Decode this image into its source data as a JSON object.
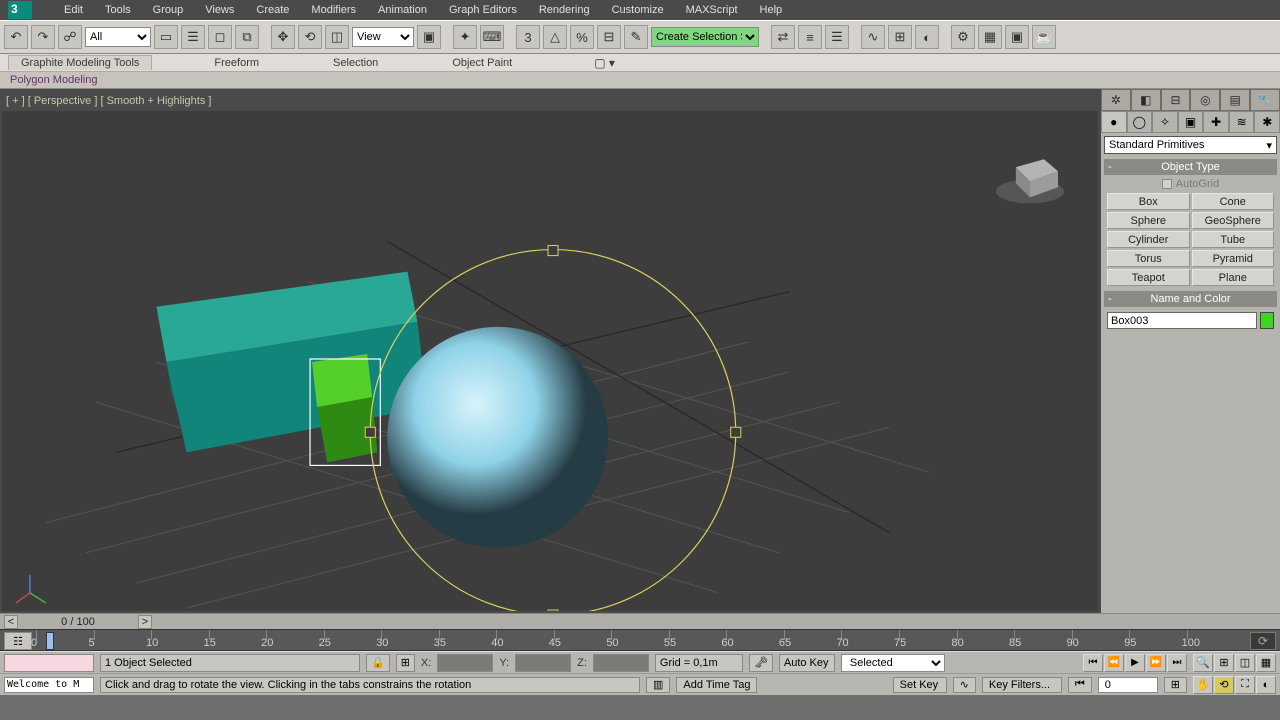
{
  "menu": {
    "items": [
      "Edit",
      "Tools",
      "Group",
      "Views",
      "Create",
      "Modifiers",
      "Animation",
      "Graph Editors",
      "Rendering",
      "Customize",
      "MAXScript",
      "Help"
    ]
  },
  "toolbar": {
    "filter_value": "All",
    "refsys_value": "View",
    "selset_value": "Create Selection Se"
  },
  "ribbon": {
    "tabs": [
      "Graphite Modeling Tools",
      "Freeform",
      "Selection",
      "Object Paint"
    ],
    "sub": "Polygon Modeling"
  },
  "viewport": {
    "label": "[ + ] [ Perspective ] [ Smooth + Highlights ]"
  },
  "panel": {
    "category": "Standard Primitives",
    "object_type_title": "Object Type",
    "autogrid": "AutoGrid",
    "primitives": [
      "Box",
      "Cone",
      "Sphere",
      "GeoSphere",
      "Cylinder",
      "Tube",
      "Torus",
      "Pyramid",
      "Teapot",
      "Plane"
    ],
    "name_color_title": "Name and Color",
    "object_name": "Box003"
  },
  "timeline": {
    "pos": "0 / 100",
    "ticks": [
      "0",
      "5",
      "10",
      "15",
      "20",
      "25",
      "30",
      "35",
      "40",
      "45",
      "50",
      "55",
      "60",
      "65",
      "70",
      "75",
      "80",
      "85",
      "90",
      "95",
      "100"
    ]
  },
  "status": {
    "selection": "1 Object Selected",
    "x": "X:",
    "y": "Y:",
    "z": "Z:",
    "grid": "Grid = 0,1m",
    "autokey": "Auto Key",
    "setkey": "Set Key",
    "selected_mode": "Selected",
    "key_filters": "Key Filters...",
    "frame": "0",
    "welcome": "Welcome to M",
    "hint": "Click and drag to rotate the view.  Clicking in the tabs constrains the rotation",
    "add_time_tag": "Add Time Tag"
  }
}
